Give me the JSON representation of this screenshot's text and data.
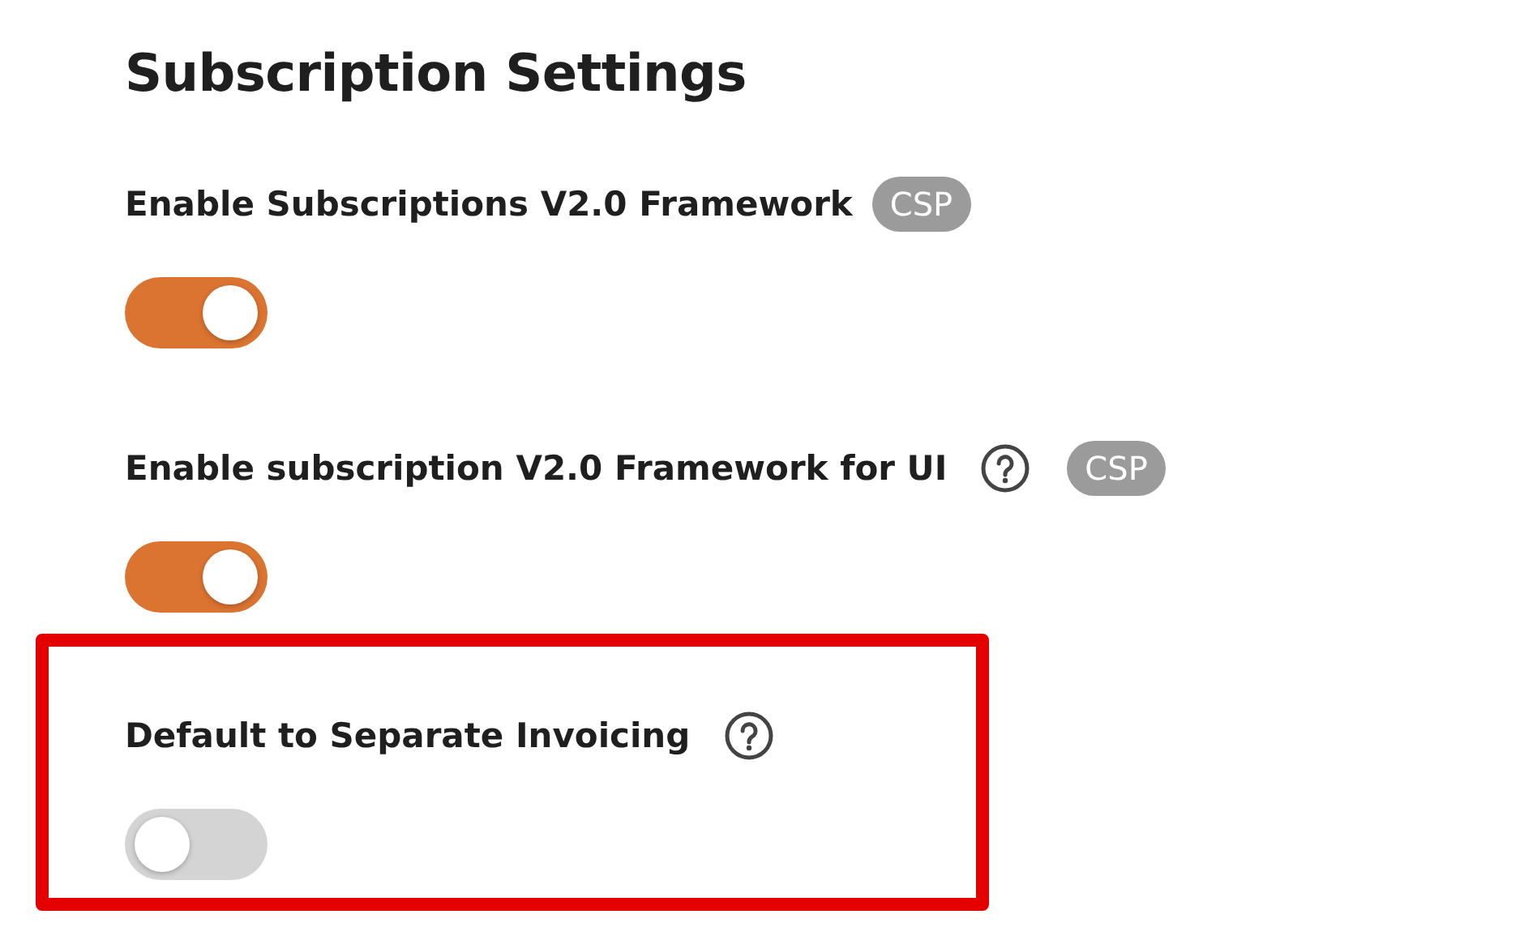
{
  "title": "Subscription Settings",
  "settings": [
    {
      "label": "Enable Subscriptions V2.0 Framework",
      "help": false,
      "badge": "CSP",
      "on": true,
      "highlighted": false
    },
    {
      "label": "Enable subscription V2.0 Framework for UI",
      "help": true,
      "badge": "CSP",
      "on": true,
      "highlighted": false
    },
    {
      "label": "Default to Separate Invoicing",
      "help": true,
      "on": false,
      "highlighted": true
    }
  ]
}
